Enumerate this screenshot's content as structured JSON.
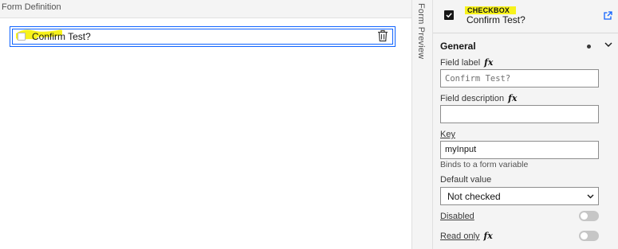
{
  "canvas": {
    "header_title": "Form Definition",
    "field": {
      "label": "Confirm Test?"
    }
  },
  "rail": {
    "label": "Form Preview"
  },
  "panel": {
    "component_type": "CHECKBOX",
    "component_name": "Confirm Test?",
    "section": {
      "title": "General"
    },
    "field_label": {
      "label": "Field label",
      "fx": "fx",
      "value": "Confirm Test?"
    },
    "field_description": {
      "label": "Field description",
      "fx": "fx",
      "value": ""
    },
    "key": {
      "label": "Key",
      "value": "myInput",
      "helper": "Binds to a form variable"
    },
    "default_value": {
      "label": "Default value",
      "selected": "Not checked"
    },
    "disabled": {
      "label": "Disabled",
      "on": false
    },
    "read_only": {
      "label": "Read only",
      "fx": "fx",
      "on": false
    }
  },
  "colors": {
    "accent": "#0f62fe",
    "highlight": "#f7f21b",
    "panel_bg": "#f4f4f4"
  },
  "icons": [
    "trash-icon",
    "checkbox-checked-icon",
    "external-link-icon",
    "chevron-down-icon",
    "unsaved-dot-icon"
  ]
}
